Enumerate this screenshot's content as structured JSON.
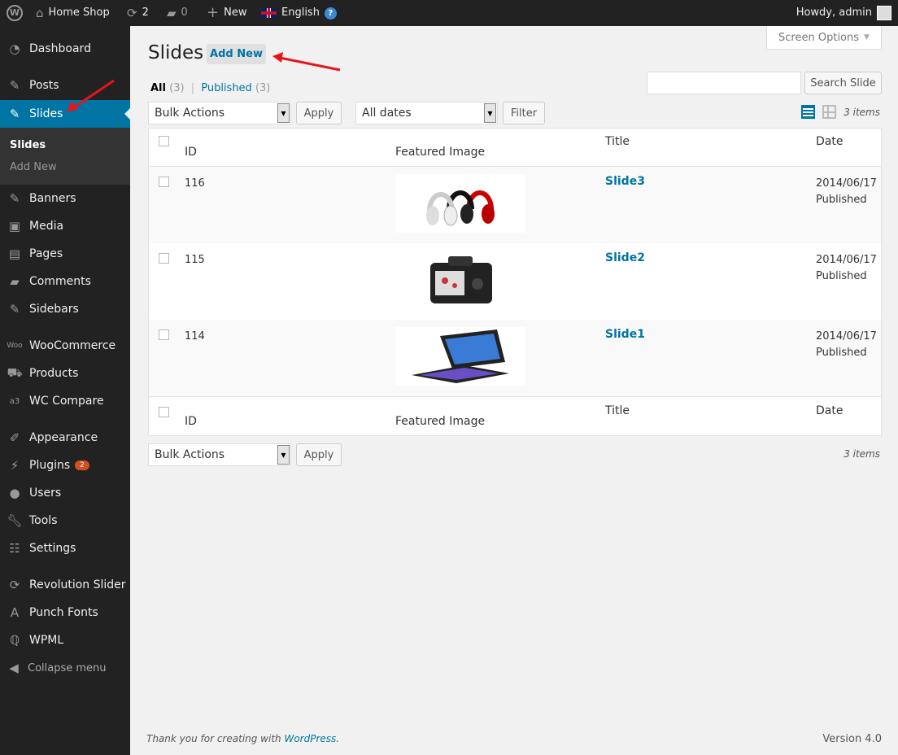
{
  "adminbar": {
    "site": "Home Shop",
    "updates": "2",
    "comments": "0",
    "new": "New",
    "language": "English",
    "howdy": "Howdy, admin"
  },
  "sidebar": {
    "items": [
      "Dashboard",
      "Posts",
      "Slides",
      "Banners",
      "Media",
      "Pages",
      "Comments",
      "Sidebars",
      "WooCommerce",
      "Products",
      "WC Compare",
      "Appearance",
      "Plugins",
      "Users",
      "Tools",
      "Settings",
      "Revolution Slider",
      "Punch Fonts",
      "WPML",
      "Collapse menu"
    ],
    "submenu": [
      "Slides",
      "Add New"
    ],
    "plugins_badge": "2"
  },
  "page": {
    "title": "Slides",
    "add_new": "Add New",
    "screen_options": "Screen Options",
    "filters": {
      "all": "All",
      "all_count": "(3)",
      "sep": "|",
      "published": "Published",
      "published_count": "(3)"
    },
    "search_button": "Search Slide",
    "search_value": "",
    "bulk_actions": "Bulk Actions",
    "apply": "Apply",
    "dates": "All dates",
    "filter": "Filter",
    "items_count": "3 items"
  },
  "table": {
    "headers": {
      "id": "ID",
      "image": "Featured Image",
      "title": "Title",
      "date": "Date"
    },
    "rows": [
      {
        "id": "116",
        "title": "Slide3",
        "date": "2014/06/17",
        "status": "Published",
        "image": "headphones"
      },
      {
        "id": "115",
        "title": "Slide2",
        "date": "2014/06/17",
        "status": "Published",
        "image": "camera"
      },
      {
        "id": "114",
        "title": "Slide1",
        "date": "2014/06/17",
        "status": "Published",
        "image": "tablet"
      }
    ]
  },
  "footer": {
    "thanks": "Thank you for creating with ",
    "wp": "WordPress",
    "dot": ".",
    "version": "Version 4.0"
  },
  "colors": {
    "accent": "#0074a2",
    "adminbar": "#222222",
    "badge": "#d54e21",
    "annotation_arrow": "#e8141b"
  }
}
